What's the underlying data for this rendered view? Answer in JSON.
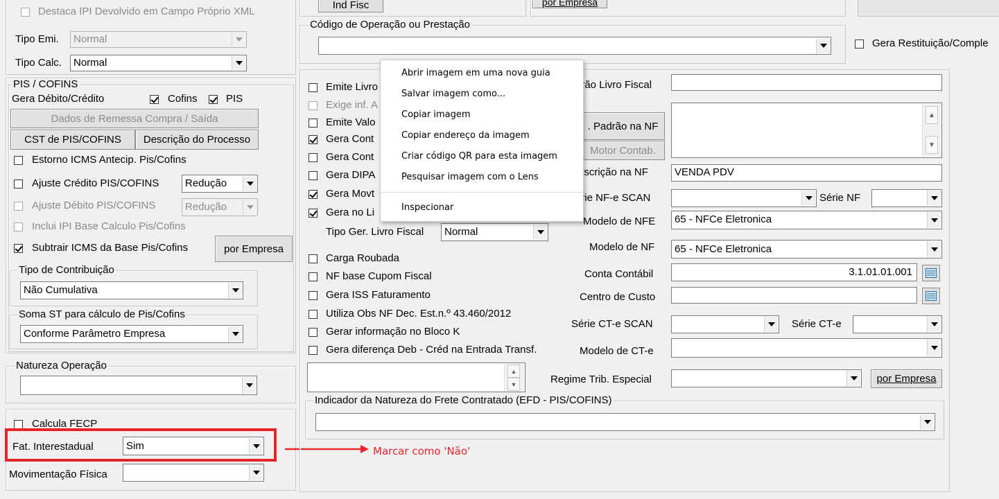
{
  "top": {
    "destaca_ipi": "Destaca IPI Devolvido em Campo Próprio XML",
    "ind_fisc": "Ind Fisc",
    "por_empresa_top": "por Empresa",
    "codigo_legend": "Código de Operação ou Prestação",
    "gera_restituicao": "Gera Restituição/Comple"
  },
  "left": {
    "tipo_emi_label": "Tipo Emi.",
    "tipo_emi_value": "Normal",
    "tipo_calc_label": "Tipo Calc.",
    "tipo_calc_value": "Normal",
    "pis_legend": "PIS / COFINS",
    "gera_debito": "Gera Débito/Crédito",
    "cofins": "Cofins",
    "pis": "PIS",
    "dados_remessa": "Dados de Remessa Compra / Saída",
    "cst_pis": "CST de PIS/COFINS",
    "descricao_processo": "Descrição do Processo",
    "estorno": "Estorno ICMS Antecip. Pis/Cofins",
    "ajuste_credito": "Ajuste Crédito PIS/COFINS",
    "ajuste_credito_value": "Redução",
    "ajuste_debito": "Ajuste Débito PIS/COFINS",
    "ajuste_debito_value": "Redução",
    "inclui_ipi": "Inclui IPI Base Calculo Pis/Cofins",
    "subtrair_icms": "Subtrair ICMS da Base Pis/Cofins",
    "por_empresa": "por Empresa",
    "tipo_contrib_legend": "Tipo de Contribuição",
    "tipo_contrib_value": "Não Cumulativa",
    "soma_st_legend": "Soma ST para cálculo de Pis/Cofins",
    "soma_st_value": "Conforme Parâmetro Empresa",
    "natureza_legend": "Natureza Operação",
    "calcula_fecp": "Calcula FECP",
    "fat_interestadual": "Fat. Interestadual",
    "fat_value": "Sim",
    "mov_fisica": "Movimentação Física"
  },
  "mid": {
    "emite_livro": "Emite Livro",
    "exige_inf": "Exige inf. A",
    "emite_valo": "Emite Valo",
    "gera_cont1": "Gera Cont",
    "gera_cont2": "Gera Cont",
    "gera_dipa": "Gera DIPA",
    "gera_movt": "Gera Movt",
    "gera_no_li": "Gera no Li",
    "tipo_ger_label": "Tipo Ger. Livro Fiscal",
    "tipo_ger_value": "Normal",
    "carga_roubada": "Carga Roubada",
    "nf_base_cupom": "NF base Cupom Fiscal",
    "gera_iss": "Gera ISS Faturamento",
    "utiliza_obs": "Utiliza Obs NF Dec. Est.n.º 43.460/2012",
    "gerar_bloco_k": "Gerar informação no Bloco K",
    "gera_diferenca": "Gera diferença Deb - Créd na Entrada Transf.",
    "indicador_legend": "Indicador da Natureza do Frete Contratado (EFD - PIS/COFINS)"
  },
  "right": {
    "padrao_livro": "drão Livro Fiscal",
    "padrao_nf_btn": ". Padrão na NF",
    "motor_contab_btn": "Motor Contab.",
    "descricao_nf_label": "escrição na NF",
    "descricao_nf_value": "VENDA PDV",
    "serie_nfe_scan": "érie NF-e SCAN",
    "serie_nf": "Série NF",
    "modelo_nfe_label": "Modelo de NFE",
    "modelo_nfe_value": "65 - NFCe Eletronica",
    "modelo_nf_label": "Modelo de NF",
    "modelo_nf_value": "65 - NFCe Eletronica",
    "conta_contabil_label": "Conta Contábil",
    "conta_contabil_value": "3.1.01.01.001",
    "centro_custo": "Centro de Custo",
    "serie_cte_scan": "Série CT-e SCAN",
    "serie_cte": "Série CT-e",
    "modelo_cte": "Modelo de CT-e",
    "regime_trib": "Regime Trib. Especial",
    "por_empresa": "por Empresa"
  },
  "context_menu": {
    "items": [
      "Abrir imagem em uma nova guia",
      "Salvar imagem como...",
      "Copiar imagem",
      "Copiar endereço da imagem",
      "Criar código QR para esta imagem",
      "Pesquisar imagem com o Lens",
      "Inspecionar"
    ]
  },
  "annotation": {
    "text": "Marcar como 'Não'",
    "color": "#e8242a"
  }
}
